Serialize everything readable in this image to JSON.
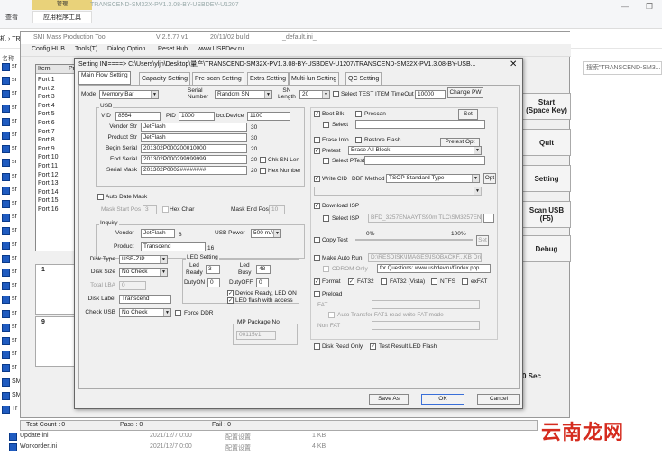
{
  "explorer": {
    "tab_manage": "管理",
    "tab_app_tools": "应用程序工具",
    "tab_view": "查看",
    "window_title": "TRANSCEND-SM32X-PV1.3.08-BY-USBDEV-U1207",
    "min_btn": "—",
    "restore_btn": "❐",
    "address_left": "机 › TR",
    "search_placeholder": "搜索\"TRANSCEND-SM3...",
    "name_header": "名称",
    "left_file_labels": [
      "sr",
      "sr",
      "sr",
      "sr",
      "sr",
      "sr",
      "sr",
      "sr",
      "sr",
      "sr",
      "sr",
      "sr",
      "sr",
      "sr",
      "sr",
      "sr",
      "sr",
      "sr",
      "sr",
      "sr",
      "sr",
      "sr",
      "sr",
      "SM",
      "SM",
      "Tr"
    ],
    "bottom_files": [
      {
        "name": "Update.ini",
        "date": "2021/12/7 0:00",
        "type": "配置设置",
        "size": "1 KB"
      },
      {
        "name": "Workorder.ini",
        "date": "2021/12/7 0:00",
        "type": "配置设置",
        "size": "4 KB"
      }
    ]
  },
  "mpt": {
    "title": "SMI Mass Production Tool",
    "version": "V 2.5.77   v1",
    "build": "20/11/02 build",
    "ini": "_default.ini_",
    "menu": [
      "Config HUB",
      "Tools(T)",
      "Dialog Option",
      "Reset Hub",
      "www.USBDev.ru"
    ],
    "port_header_item": "Item",
    "port_header_pr": "Pr",
    "ports": [
      "Port 1",
      "Port 2",
      "Port 3",
      "Port 4",
      "Port 5",
      "Port 6",
      "Port 7",
      "Port 8",
      "Port 9",
      "Port 10",
      "Port 11",
      "Port 12",
      "Port 13",
      "Port 14",
      "Port 15",
      "Port 16"
    ],
    "slot1": "1",
    "slot9": "9",
    "buttons": {
      "start": "Start\n(Space Key)",
      "quit": "Quit",
      "setting": "Setting",
      "scan": "Scan USB\n(F5)",
      "debug": "Debug"
    },
    "zero_sec": "0 Sec",
    "status": {
      "test_count": "Test Count : 0",
      "pass": "Pass : 0",
      "fail": "Fail : 0"
    }
  },
  "dialog": {
    "title": "Setting  INI====> C:\\Users\\yljn\\Desktop\\量产\\TRANSCEND-SM32X-PV1.3.08-BY-USBDEV-U1207\\TRANSCEND-SM32X-PV1.3.08-BY-USB...",
    "tabs": [
      "Main Flow Setting",
      "Capacity Setting",
      "Pre-scan Setting",
      "Extra Setting",
      "Multi-lun Setting",
      "QC Setting"
    ],
    "mode_label": "Mode",
    "mode_value": "Memory Bar",
    "serial_number_label": "Serial\nNumber",
    "serial_number_value": "Random SN",
    "sn_length_label": "SN\nLength",
    "sn_length_value": "20",
    "select_test_item": "Select TEST ITEM",
    "timeout_label": "TimeOut",
    "timeout_value": "10000",
    "change_pw": "Change PW",
    "usb_group": "USB",
    "vid_label": "VID",
    "vid_value": "8564",
    "pid_label": "PID",
    "pid_value": "1000",
    "bcd_label": "bcdDevice",
    "bcd_value": "1100",
    "vendor_str_label": "Vendor Str",
    "vendor_str_value": "JetFlash",
    "vendor_str_len": "30",
    "product_str_label": "Product Str",
    "product_str_value": "JetFlash",
    "product_str_len": "30",
    "begin_serial_label": "Begin Serial",
    "begin_serial_value": "201302P000200010000",
    "begin_serial_len": "20",
    "end_serial_label": "End Serial",
    "end_serial_value": "201302P000299999999",
    "end_serial_len": "20",
    "chk_sn_len": "Chk SN Len",
    "serial_mask_label": "Serial Mask",
    "serial_mask_value": "201302P0002########",
    "serial_mask_len": "20",
    "hex_number": "Hex Number",
    "auto_date_mask": "Auto Date Mask",
    "mask_start_pos": "Mask Start Pos",
    "mask_start_value": "3",
    "hex_char": "Hex Char",
    "mask_end_pos": "Mask End Pos",
    "mask_end_value": "10",
    "inquiry_group": "Inquiry",
    "inq_vendor_label": "Vendor",
    "inq_vendor_value": "JetFlash",
    "inq_vendor_len": "8",
    "inq_product_label": "Product",
    "inq_product_value": "Transcend",
    "inq_product_len": "16",
    "usb_power_label": "USB Power",
    "usb_power_value": "500 mA",
    "disk_type_label": "Disk Type",
    "disk_type_value": "USB-ZIP",
    "disk_size_label": "Disk Size",
    "disk_size_value": "No Check",
    "total_lba_label": "Total LBA",
    "total_lba_value": "0",
    "disk_label_label": "Disk Label",
    "disk_label_value": "Transcend",
    "check_usb_label": "Check USB",
    "check_usb_value": "No Check",
    "force_ddr": "Force DDR",
    "led_group": "LED Setting",
    "led_ready_label": "Led\nReady",
    "led_ready_value": "3",
    "led_busy_label": "Led\nBusy",
    "led_busy_value": "48",
    "duty_on_label": "DutyON",
    "duty_on_value": "0",
    "duty_off_label": "DutyOFF",
    "duty_off_value": "0",
    "device_ready_led": "Device Ready, LED ON",
    "led_flash_access": "LED flash with access",
    "mp_package_group": "MP Package No",
    "mp_package_value": "00115v1",
    "boot_blk": "Boot Blk",
    "prescan": "Prescan",
    "set_btn": "Set",
    "select1": "Select",
    "erase_info": "Erase Info",
    "restore_flash": "Restore Flash",
    "pretest_opt": "Pretest Opt",
    "pretest": "Pretest",
    "pretest_value": "Erase All Block",
    "select_ptest": "Select PTest",
    "write_cid": "Write CID",
    "dbf_method": "DBF Method",
    "dbf_value": "TSOP Standard Type",
    "opt_btn": "Opt",
    "download_isp": "Download ISP",
    "select_isp": "Select ISP",
    "isp_value": "BFD_3257ENAAYTS90m TLC\\SM3257EN",
    "copy_test": "Copy Test",
    "pct_0": "0%",
    "pct_100": "100%",
    "set_small": "Set",
    "make_auto_run": "Make Auto Run",
    "auto_run_path": "D:\\RESDISK\\IMAGES\\ISOBACKF...KB Driver",
    "cdrom_only": "CDROM Only",
    "for_questions": "for Questions: www.usbdev.ru/f/index.php",
    "format": "Format",
    "fat32": "FAT32",
    "fat32_vista": "FAT32 (Vista)",
    "ntfs": "NTFS",
    "exfat": "exFAT",
    "preload": "Preload",
    "preload_fat": "FAT",
    "auto_transfer": "Auto Transfer FAT1 read-write FAT mode",
    "non_fat": "Non FAT",
    "disk_read_only": "Disk Read Only",
    "test_result_led": "Test Result LED Flash",
    "save_as": "Save As",
    "ok": "OK",
    "cancel": "Cancel",
    "close": "✕"
  },
  "watermark": "云南龙网"
}
